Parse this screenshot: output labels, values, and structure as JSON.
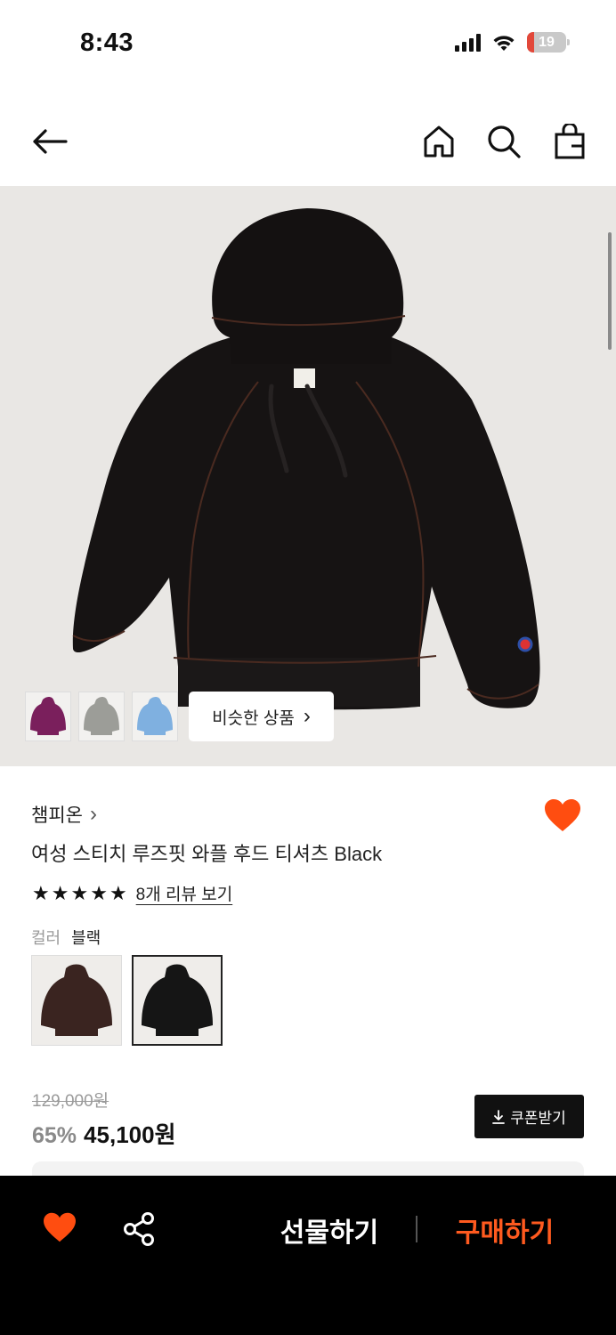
{
  "status_bar": {
    "time": "8:43",
    "battery": "19"
  },
  "nav": {
    "icons": [
      "back-arrow-icon",
      "home-icon",
      "search-icon",
      "shopping-bag-icon"
    ]
  },
  "hero": {
    "thumbnail_colors": [
      "#7a1f5c",
      "#9c9d98",
      "#7fb0e0"
    ],
    "similar_label": "비슷한 상품",
    "chevron": "›"
  },
  "product": {
    "brand": "챔피온",
    "brand_chevron": "›",
    "title": "여성 스티치 루즈핏 와플 후드 티셔츠 Black",
    "rating_stars": 5,
    "review_link": "8개 리뷰 보기",
    "color_label": "컬러",
    "color_value": "블랙",
    "swatch_colors": [
      "#3a2420",
      "#151515"
    ]
  },
  "price": {
    "original": "129,000원",
    "discount": "65%",
    "sale": "45,100원",
    "coupon_label": "쿠폰받기"
  },
  "bottom_bar": {
    "gift_label": "선물하기",
    "buy_label": "구매하기"
  },
  "colors": {
    "accent": "#ff5a1f",
    "heart": "#ff4d10",
    "dark": "#111111"
  }
}
